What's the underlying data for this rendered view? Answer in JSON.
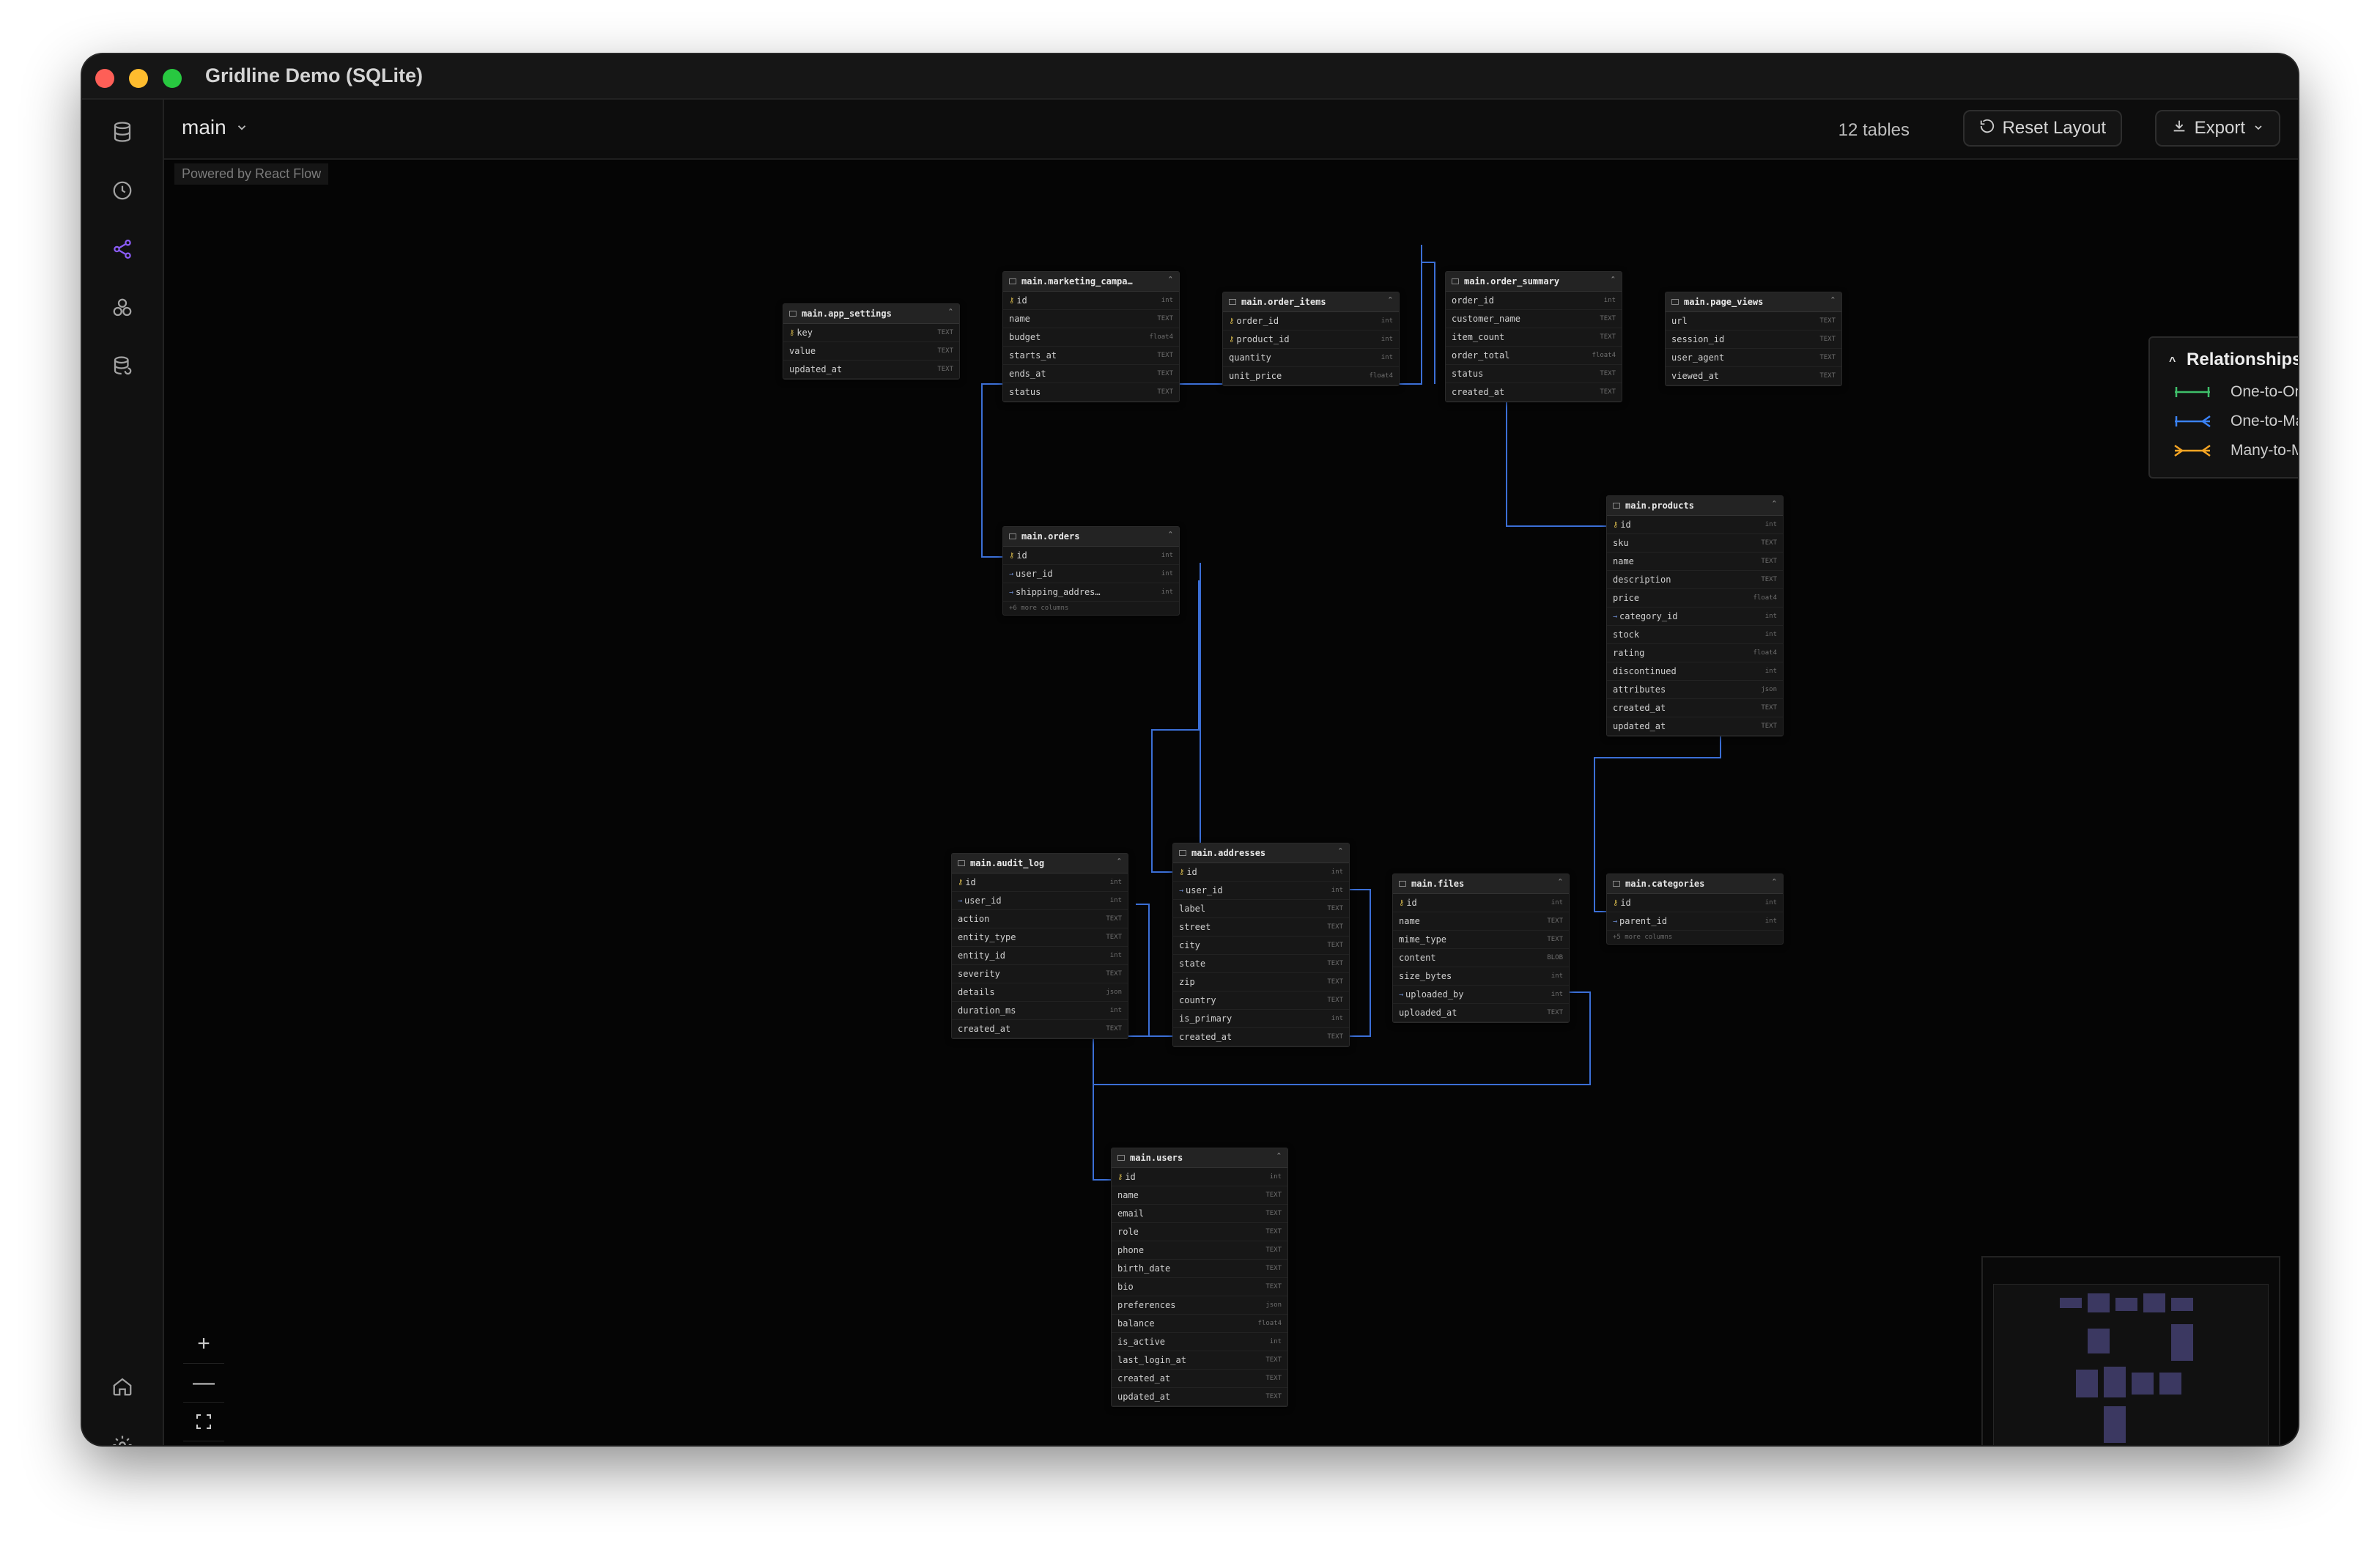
{
  "window": {
    "title": "Gridline Demo (SQLite)"
  },
  "sidebar": {
    "items": [
      {
        "name": "database-icon"
      },
      {
        "name": "history-icon"
      },
      {
        "name": "share-nodes-icon",
        "active": true
      },
      {
        "name": "cluster-icon"
      },
      {
        "name": "database-refresh-icon"
      },
      {
        "name": "home-icon"
      },
      {
        "name": "gear-icon"
      }
    ],
    "accent": "#8b5cf6"
  },
  "topbar": {
    "schema": "main",
    "table_count": "12 tables",
    "reset_label": "Reset Layout",
    "export_label": "Export"
  },
  "canvas": {
    "powered_by": "Powered by React Flow"
  },
  "legend": {
    "title": "Relationships",
    "items": [
      {
        "label": "One-to-One",
        "color": "#3fbf6a"
      },
      {
        "label": "One-to-Many",
        "color": "#3b82f6"
      },
      {
        "label": "Many-to-Many",
        "color": "#f5a524"
      }
    ]
  },
  "tables": [
    {
      "name": "main.app_settings",
      "columns": [
        [
          "key",
          "TEXT",
          "pk"
        ],
        [
          "value",
          "TEXT",
          ""
        ],
        [
          "updated_at",
          "TEXT",
          ""
        ]
      ]
    },
    {
      "name": "main.marketing_campa…",
      "columns": [
        [
          "id",
          "int",
          "pk"
        ],
        [
          "name",
          "TEXT",
          ""
        ],
        [
          "budget",
          "float4",
          ""
        ],
        [
          "starts_at",
          "TEXT",
          ""
        ],
        [
          "ends_at",
          "TEXT",
          ""
        ],
        [
          "status",
          "TEXT",
          ""
        ]
      ]
    },
    {
      "name": "main.order_items",
      "columns": [
        [
          "order_id",
          "int",
          "pk"
        ],
        [
          "product_id",
          "int",
          "pk"
        ],
        [
          "quantity",
          "int",
          ""
        ],
        [
          "unit_price",
          "float4",
          ""
        ]
      ]
    },
    {
      "name": "main.order_summary",
      "columns": [
        [
          "order_id",
          "int",
          ""
        ],
        [
          "customer_name",
          "TEXT",
          ""
        ],
        [
          "item_count",
          "TEXT",
          ""
        ],
        [
          "order_total",
          "float4",
          ""
        ],
        [
          "status",
          "TEXT",
          ""
        ],
        [
          "created_at",
          "TEXT",
          ""
        ]
      ]
    },
    {
      "name": "main.page_views",
      "columns": [
        [
          "url",
          "TEXT",
          ""
        ],
        [
          "session_id",
          "TEXT",
          ""
        ],
        [
          "user_agent",
          "TEXT",
          ""
        ],
        [
          "viewed_at",
          "TEXT",
          ""
        ]
      ]
    },
    {
      "name": "main.orders",
      "columns": [
        [
          "id",
          "int",
          "pk"
        ],
        [
          "user_id",
          "int",
          "fk"
        ],
        [
          "shipping_addres…",
          "int",
          "fk"
        ]
      ],
      "more": "+6 more columns"
    },
    {
      "name": "main.products",
      "columns": [
        [
          "id",
          "int",
          "pk"
        ],
        [
          "sku",
          "TEXT",
          ""
        ],
        [
          "name",
          "TEXT",
          ""
        ],
        [
          "description",
          "TEXT",
          ""
        ],
        [
          "price",
          "float4",
          ""
        ],
        [
          "category_id",
          "int",
          "fk"
        ],
        [
          "stock",
          "int",
          ""
        ],
        [
          "rating",
          "float4",
          ""
        ],
        [
          "discontinued",
          "int",
          ""
        ],
        [
          "attributes",
          "json",
          ""
        ],
        [
          "created_at",
          "TEXT",
          ""
        ],
        [
          "updated_at",
          "TEXT",
          ""
        ]
      ]
    },
    {
      "name": "main.audit_log",
      "columns": [
        [
          "id",
          "int",
          "pk"
        ],
        [
          "user_id",
          "int",
          "fk"
        ],
        [
          "action",
          "TEXT",
          ""
        ],
        [
          "entity_type",
          "TEXT",
          ""
        ],
        [
          "entity_id",
          "int",
          ""
        ],
        [
          "severity",
          "TEXT",
          ""
        ],
        [
          "details",
          "json",
          ""
        ],
        [
          "duration_ms",
          "int",
          ""
        ],
        [
          "created_at",
          "TEXT",
          ""
        ]
      ]
    },
    {
      "name": "main.addresses",
      "columns": [
        [
          "id",
          "int",
          "pk"
        ],
        [
          "user_id",
          "int",
          "fk"
        ],
        [
          "label",
          "TEXT",
          ""
        ],
        [
          "street",
          "TEXT",
          ""
        ],
        [
          "city",
          "TEXT",
          ""
        ],
        [
          "state",
          "TEXT",
          ""
        ],
        [
          "zip",
          "TEXT",
          ""
        ],
        [
          "country",
          "TEXT",
          ""
        ],
        [
          "is_primary",
          "int",
          ""
        ],
        [
          "created_at",
          "TEXT",
          ""
        ]
      ]
    },
    {
      "name": "main.files",
      "columns": [
        [
          "id",
          "int",
          "pk"
        ],
        [
          "name",
          "TEXT",
          ""
        ],
        [
          "mime_type",
          "TEXT",
          ""
        ],
        [
          "content",
          "BLOB",
          ""
        ],
        [
          "size_bytes",
          "int",
          ""
        ],
        [
          "uploaded_by",
          "int",
          "fk"
        ],
        [
          "uploaded_at",
          "TEXT",
          ""
        ]
      ]
    },
    {
      "name": "main.categories",
      "columns": [
        [
          "id",
          "int",
          "pk"
        ],
        [
          "parent_id",
          "int",
          "fk"
        ]
      ],
      "more": "+5 more columns"
    },
    {
      "name": "main.users",
      "columns": [
        [
          "id",
          "int",
          "pk"
        ],
        [
          "name",
          "TEXT",
          ""
        ],
        [
          "email",
          "TEXT",
          ""
        ],
        [
          "role",
          "TEXT",
          ""
        ],
        [
          "phone",
          "TEXT",
          ""
        ],
        [
          "birth_date",
          "TEXT",
          ""
        ],
        [
          "bio",
          "TEXT",
          ""
        ],
        [
          "preferences",
          "json",
          ""
        ],
        [
          "balance",
          "float4",
          ""
        ],
        [
          "is_active",
          "int",
          ""
        ],
        [
          "last_login_at",
          "TEXT",
          ""
        ],
        [
          "created_at",
          "TEXT",
          ""
        ],
        [
          "updated_at",
          "TEXT",
          ""
        ]
      ]
    }
  ]
}
